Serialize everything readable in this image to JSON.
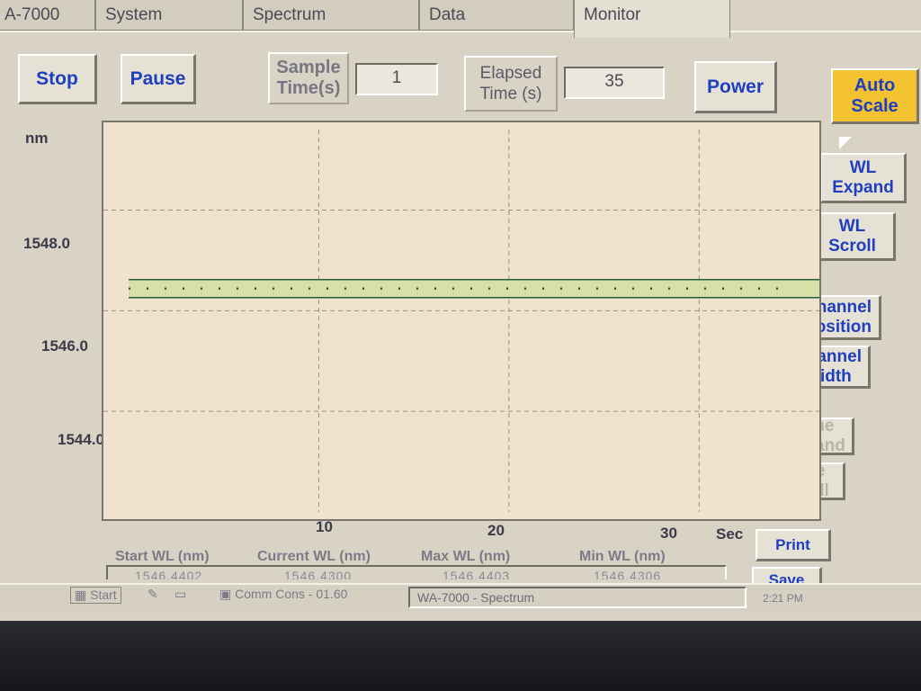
{
  "tabs": [
    {
      "label": "A-7000"
    },
    {
      "label": "System"
    },
    {
      "label": "Spectrum"
    },
    {
      "label": "Data"
    },
    {
      "label": "Monitor"
    }
  ],
  "toolbar": {
    "stop_label": "Stop",
    "pause_label": "Pause",
    "sample_time_label": "Sample\nTime(s)",
    "sample_time_value": "1",
    "elapsed_time_label": "Elapsed\nTime (s)",
    "elapsed_time_value": "35",
    "power_label": "Power",
    "auto_scale_label": "Auto\nScale"
  },
  "side_buttons": {
    "wl_expand": "WL\nExpand",
    "wl_scroll": "WL\nScroll",
    "channel_position": "Channel\nPosition",
    "channel_width": "Channel\nWidth",
    "time_expand": "Time\nExpand",
    "time_scroll": "Time\nScroll",
    "print": "Print",
    "save": "Save"
  },
  "chart_data": {
    "type": "line",
    "ylabel": "nm",
    "xlabel": "Sec",
    "yticks": [
      "1548.0",
      "1546.0",
      "1544.0"
    ],
    "xticks": [
      "10",
      "20",
      "30"
    ],
    "xlim": [
      0,
      35
    ],
    "ylim": [
      1542.0,
      1549.6
    ],
    "grid": true,
    "series": [
      {
        "x": [
          0,
          35
        ],
        "y": [
          1546.44,
          1546.44
        ],
        "color": "#1f5f3f",
        "band_color": "#d8e0a8"
      }
    ]
  },
  "table": {
    "headers": [
      "Start WL (nm)",
      "Current WL (nm)",
      "Max WL (nm)",
      "Min WL (nm)"
    ],
    "values": [
      "1546.4402",
      "1546.4300",
      "1546.4403",
      "1546.4306"
    ]
  },
  "taskbar": {
    "start": "Start",
    "comm": "Comm Cons - 01.60",
    "task": "WA-7000 - Spectrum",
    "clock": "2:21 PM"
  }
}
